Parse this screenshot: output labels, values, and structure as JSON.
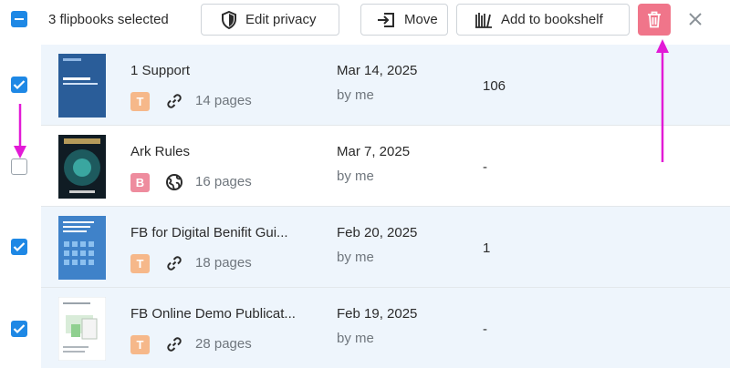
{
  "toolbar": {
    "selection_text": "3 flipbooks selected",
    "edit_privacy_label": "Edit privacy",
    "move_label": "Move",
    "bookshelf_label": "Add to bookshelf"
  },
  "colors": {
    "accent": "#1e88e5",
    "delete": "#f0758a",
    "badge_t": "#f6b88a",
    "badge_b": "#ee8c9e",
    "selected_row": "#eef5fc",
    "annotation_arrow": "#e21ad6"
  },
  "rows": [
    {
      "selected": true,
      "title": "1 Support",
      "badge": "T",
      "link_icon": "link-icon",
      "pages": "14 pages",
      "date": "Mar 14, 2025",
      "owner": "by me",
      "views": "106",
      "thumb_text": "PUBLISHER QUICK START GUIDE"
    },
    {
      "selected": false,
      "title": "Ark Rules",
      "badge": "B",
      "link_icon": "globe-icon",
      "pages": "16 pages",
      "date": "Mar 7, 2025",
      "owner": "by me",
      "views": "-",
      "thumb_text": "ARKHAM HORROR"
    },
    {
      "selected": true,
      "title": "FB for Digital Benifit Gui...",
      "badge": "T",
      "link_icon": "link-icon",
      "pages": "18 pages",
      "date": "Feb 20, 2025",
      "owner": "by me",
      "views": "1",
      "thumb_text": "FLIPPINGBOOK FOR DIGITAL BENEFIT GUIDES"
    },
    {
      "selected": true,
      "title": "FB Online Demo Publicat...",
      "badge": "T",
      "link_icon": "link-icon",
      "pages": "28 pages",
      "date": "Feb 19, 2025",
      "owner": "by me",
      "views": "-",
      "thumb_text": "FLIPPINGBOOK ONLINE"
    }
  ]
}
